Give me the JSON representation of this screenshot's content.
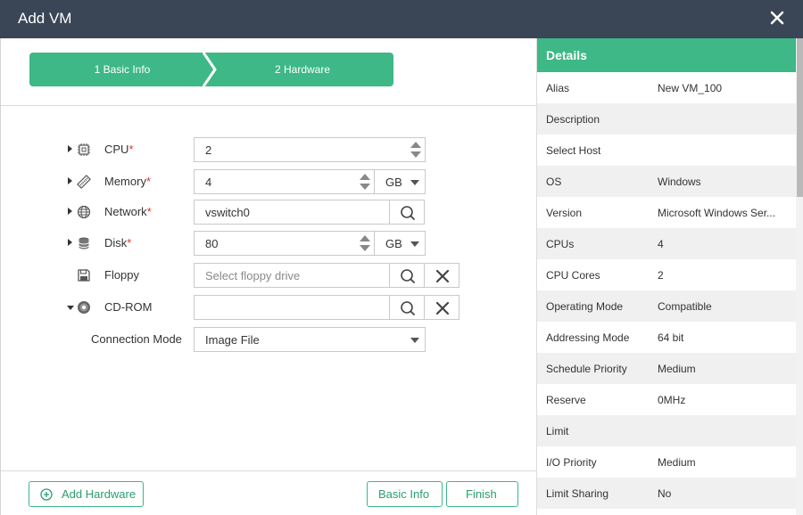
{
  "dialog": {
    "title": "Add VM"
  },
  "steps": [
    {
      "label": "1 Basic Info"
    },
    {
      "label": "2 Hardware"
    }
  ],
  "hardware": {
    "cpu": {
      "label": "CPU",
      "required": "*",
      "value": "2",
      "icon": "cpu-chip-icon"
    },
    "memory": {
      "label": "Memory",
      "required": "*",
      "value": "4",
      "unit": "GB",
      "icon": "memory-icon"
    },
    "network": {
      "label": "Network",
      "required": "*",
      "value": "vswitch0",
      "icon": "globe-icon"
    },
    "disk": {
      "label": "Disk",
      "required": "*",
      "value": "80",
      "unit": "GB",
      "icon": "database-icon"
    },
    "floppy": {
      "label": "Floppy",
      "placeholder": "Select floppy drive",
      "icon": "floppy-icon"
    },
    "cdrom": {
      "label": "CD-ROM",
      "value": "",
      "icon": "disc-icon"
    },
    "connection_mode": {
      "label": "Connection Mode",
      "value": "Image File"
    }
  },
  "footer": {
    "add_hardware": "Add Hardware",
    "basic_info": "Basic Info",
    "finish": "Finish"
  },
  "details": {
    "title": "Details",
    "rows": [
      {
        "key": "Alias",
        "value": "New VM_100"
      },
      {
        "key": "Description",
        "value": ""
      },
      {
        "key": "Select Host",
        "value": ""
      },
      {
        "key": "OS",
        "value": "Windows"
      },
      {
        "key": "Version",
        "value": "Microsoft Windows Ser..."
      },
      {
        "key": "CPUs",
        "value": "4"
      },
      {
        "key": "CPU Cores",
        "value": "2"
      },
      {
        "key": "Operating Mode",
        "value": "Compatible"
      },
      {
        "key": "Addressing Mode",
        "value": "64 bit"
      },
      {
        "key": "Schedule Priority",
        "value": "Medium"
      },
      {
        "key": "Reserve",
        "value": "0MHz"
      },
      {
        "key": "Limit",
        "value": ""
      },
      {
        "key": "I/O Priority",
        "value": "Medium"
      },
      {
        "key": "Limit Sharing",
        "value": "No"
      }
    ]
  },
  "colors": {
    "accent": "#3db886",
    "titlebar": "#3a4555",
    "required": "#e0312b"
  }
}
